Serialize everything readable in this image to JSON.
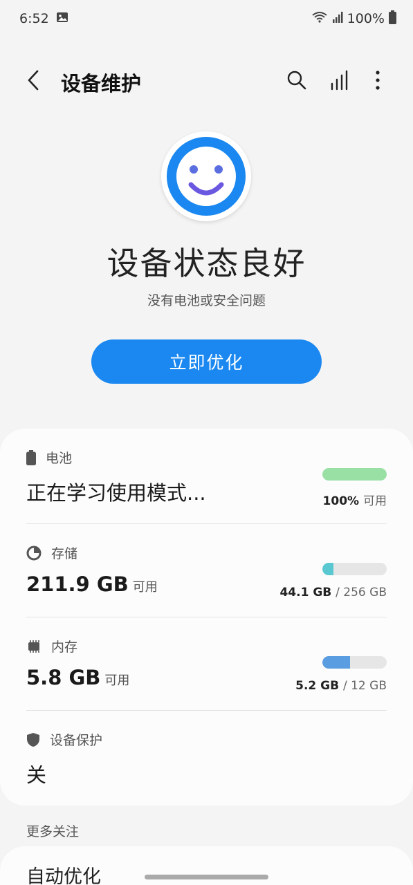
{
  "status_bar": {
    "time": "6:52",
    "battery": "100%"
  },
  "app_bar": {
    "title": "设备维护",
    "icons": [
      "back-icon",
      "search-icon",
      "signal-bars-icon",
      "more-vert-icon"
    ]
  },
  "hero": {
    "title": "设备状态良好",
    "subtitle": "没有电池或安全问题",
    "button": "立即优化"
  },
  "battery": {
    "label": "电池",
    "value": "正在学习使用模式...",
    "level": 1.0,
    "meta_value": "100%",
    "meta_suffix": "可用"
  },
  "storage": {
    "label": "存储",
    "value": "211.9 GB",
    "value_suffix": "可用",
    "used_fraction": 0.17,
    "used": "44.1 GB",
    "total": "/ 256 GB"
  },
  "memory": {
    "label": "内存",
    "value": "5.8 GB",
    "value_suffix": "可用",
    "used_fraction": 0.43,
    "used": "5.2 GB",
    "total": "/ 12 GB"
  },
  "protection": {
    "label": "设备保护",
    "value": "关"
  },
  "more": {
    "title": "更多关注",
    "next_item": "自动优化"
  },
  "colors": {
    "accent": "#1a88f0",
    "battery_bar": "#98e0a4",
    "storage_bar": "#5ac8d0",
    "memory_bar": "#5a9de0"
  }
}
